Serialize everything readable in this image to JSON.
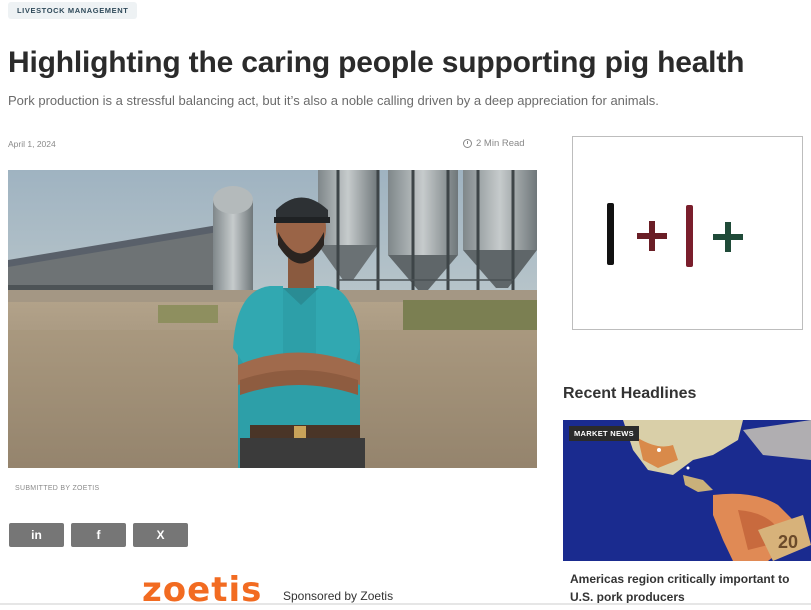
{
  "category_tag": "LIVESTOCK MANAGEMENT",
  "article": {
    "title": "Highlighting the caring people supporting pig health",
    "subtitle": "Pork production is a stressful balancing act, but it’s also a noble calling driven by a deep appreciation for animals.",
    "date": "April 1, 2024",
    "read_time": "2 Min Read",
    "image_caption": "SUBMITTED BY ZOETIS"
  },
  "share": {
    "linkedin": "in",
    "facebook": "f",
    "x": "X"
  },
  "sponsor": {
    "logo_text": "zoetis",
    "label": "Sponsored by Zoetis"
  },
  "sidebar": {
    "recent_title": "Recent Headlines",
    "news": {
      "badge": "MARKET NEWS",
      "headline": "Americas region critically important to U.S. pork producers"
    }
  },
  "colors": {
    "sponsor_orange": "#f26b21",
    "share_gray": "#767676",
    "news_map_blue": "#1a2b8f"
  }
}
